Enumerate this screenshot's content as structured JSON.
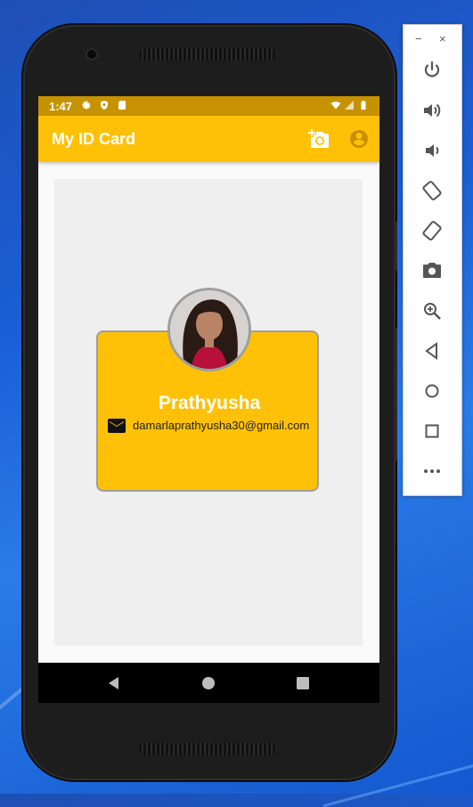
{
  "status_bar": {
    "time": "1:47"
  },
  "app_bar": {
    "title": "My ID Card",
    "icons": [
      "add-a-photo-icon",
      "account-circle-icon"
    ]
  },
  "card": {
    "name": "Prathyusha",
    "email": "damarlaprathyusha30@gmail.com"
  },
  "nav_bar": {
    "buttons": [
      "back",
      "home",
      "overview"
    ]
  },
  "emulator_toolbar": {
    "window_controls": {
      "minimize": "−",
      "close": "×"
    },
    "buttons": [
      "power",
      "volume-up",
      "volume-down",
      "rotate-left",
      "rotate-right",
      "take-screenshot",
      "zoom",
      "back",
      "home",
      "overview",
      "more"
    ]
  },
  "colors": {
    "accent": "#ffc107",
    "status_bar": "#c79200",
    "desktop": "#1a5fd6"
  }
}
